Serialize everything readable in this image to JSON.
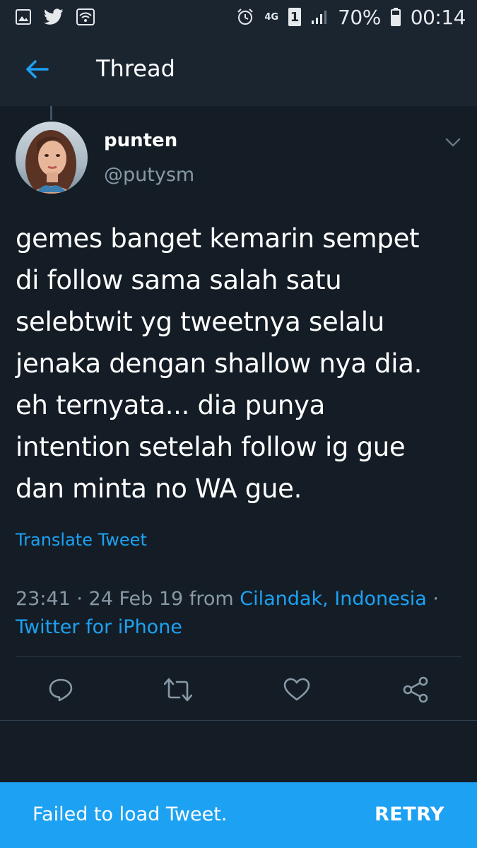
{
  "status_bar": {
    "battery": "70%",
    "time": "00:14",
    "network": "4G",
    "sim": "1",
    "icons": [
      "gallery-icon",
      "twitter-bird-icon",
      "wifi-icon",
      "alarm-icon",
      "signal-icon",
      "battery-icon"
    ]
  },
  "header": {
    "title": "Thread",
    "back_icon": "back-arrow-icon"
  },
  "tweet": {
    "name": "punten",
    "handle": "@putysm",
    "lines": [
      "gemes banget kemarin sempet",
      "di follow sama salah satu",
      "selebtwit yg tweetnya selalu",
      "jenaka dengan shallow nya dia.",
      "eh ternyata... dia punya",
      "intention setelah follow ig gue",
      "dan minta no WA gue."
    ],
    "translate": "Translate Tweet",
    "meta": {
      "time_date": "23:41 · 24 Feb 19 from ",
      "location": "Cilandak, Indonesia",
      "separator": " ·",
      "client": "Twitter for iPhone"
    },
    "actions": [
      "reply-icon",
      "retweet-icon",
      "like-icon",
      "share-icon"
    ]
  },
  "snackbar": {
    "message": "Failed to load Tweet.",
    "action": "RETRY"
  },
  "colors": {
    "background": "#141d26",
    "header": "#1b2530",
    "accent": "#1da1f2",
    "muted": "#8899a6"
  }
}
